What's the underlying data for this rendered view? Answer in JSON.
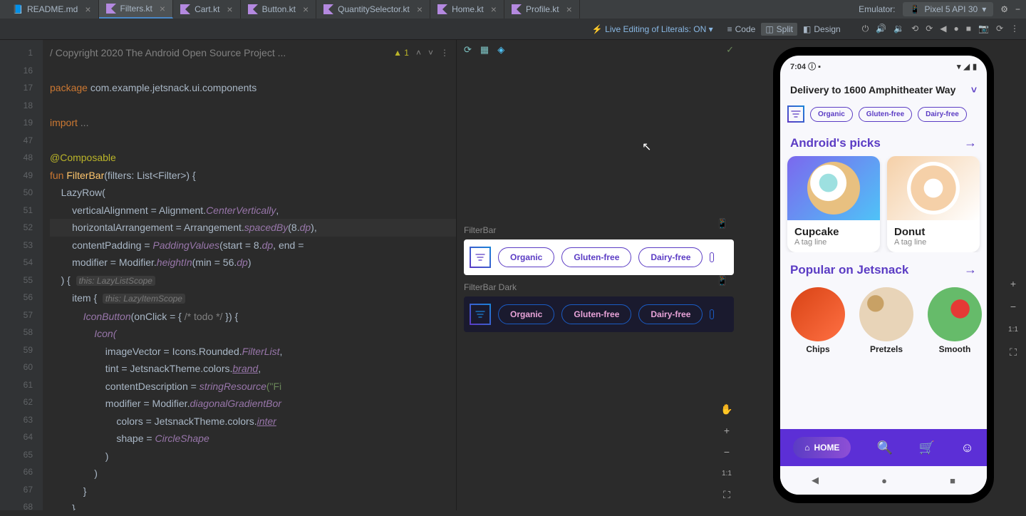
{
  "tabs": [
    {
      "name": "README.md",
      "type": "md"
    },
    {
      "name": "Filters.kt",
      "type": "kt",
      "active": true
    },
    {
      "name": "Cart.kt",
      "type": "kt"
    },
    {
      "name": "Button.kt",
      "type": "kt"
    },
    {
      "name": "QuantitySelector.kt",
      "type": "kt"
    },
    {
      "name": "Home.kt",
      "type": "kt"
    },
    {
      "name": "Profile.kt",
      "type": "kt"
    }
  ],
  "emulator_label": "Emulator:",
  "emulator_device": "Pixel 5 API 30",
  "live_edit": "Live Editing of Literals: ON",
  "view_modes": {
    "code": "Code",
    "split": "Split",
    "design": "Design"
  },
  "gutter_numbers": [
    "1",
    "16",
    "17",
    "18",
    "19",
    "47",
    "48",
    "49",
    "50",
    "51",
    "52",
    "53",
    "54",
    "55",
    "56",
    "57",
    "58",
    "59",
    "60",
    "61",
    "62",
    "63",
    "64",
    "65",
    "66",
    "67",
    "68"
  ],
  "warn_count": "1",
  "preview": {
    "label_light": "FilterBar",
    "label_dark": "FilterBar Dark",
    "chips": [
      "Organic",
      "Gluten-free",
      "Dairy-free"
    ]
  },
  "app": {
    "time": "7:04",
    "delivery": "Delivery to 1600 Amphitheater Way",
    "chips": [
      "Organic",
      "Gluten-free",
      "Dairy-free"
    ],
    "section1": "Android's picks",
    "section2": "Popular on Jetsnack",
    "cards": [
      {
        "title": "Cupcake",
        "sub": "A tag line"
      },
      {
        "title": "Donut",
        "sub": "A tag line"
      }
    ],
    "snacks": [
      "Chips",
      "Pretzels",
      "Smooth"
    ],
    "nav_home": "HOME"
  },
  "code": {
    "copyright": "/ Copyright 2020 The Android Open Source Project ...",
    "pkg_kw": "package",
    "pkg": "com.example.jetsnack.ui.components",
    "import_kw": "import",
    "import_rest": "...",
    "anno": "@Composable",
    "fun_kw": "fun",
    "fn_name": "FilterBar",
    "fn_sig": "(filters: List<Filter>) {",
    "lazyrow": "LazyRow(",
    "va": "verticalAlignment = Alignment.",
    "va2": "CenterVertically",
    "ha": "horizontalArrangement = Arrangement.",
    "ha2": "spacedBy",
    "ha3": "(8.",
    "dp": "dp",
    "ha4": "),",
    "cp": "contentPadding = ",
    "cp2": "PaddingValues",
    "cp3": "(start = 8.",
    "cp4": ", end = ",
    "mod": "modifier = Modifier.",
    "mod2": "heightIn",
    "mod3": "(min = 56.",
    "close_paren": ") {",
    "hint1": "this: LazyListScope",
    "item": "item {",
    "hint2": "this: LazyItemScope",
    "iconbtn": "IconButton",
    "iconbtn2": "(onClick = { ",
    "todo": "/* todo */",
    "iconbtn3": " }) {",
    "icon": "Icon(",
    "iv": "imageVector = Icons.Rounded.",
    "iv2": "FilterList",
    "tint": "tint = JetsnackTheme.colors.",
    "brand": "brand",
    "cd": "contentDescription = ",
    "cd2": "stringResource",
    "cd3": "(\"Fi",
    "dgb": "modifier = Modifier.",
    "dgb2": "diagonalGradientBor",
    "colors": "colors = JetsnackTheme.colors.",
    "inter": "inter",
    "shape": "shape = ",
    "shape2": "CircleShape",
    "close1": ")",
    "close2": "}",
    "close3": "}"
  }
}
